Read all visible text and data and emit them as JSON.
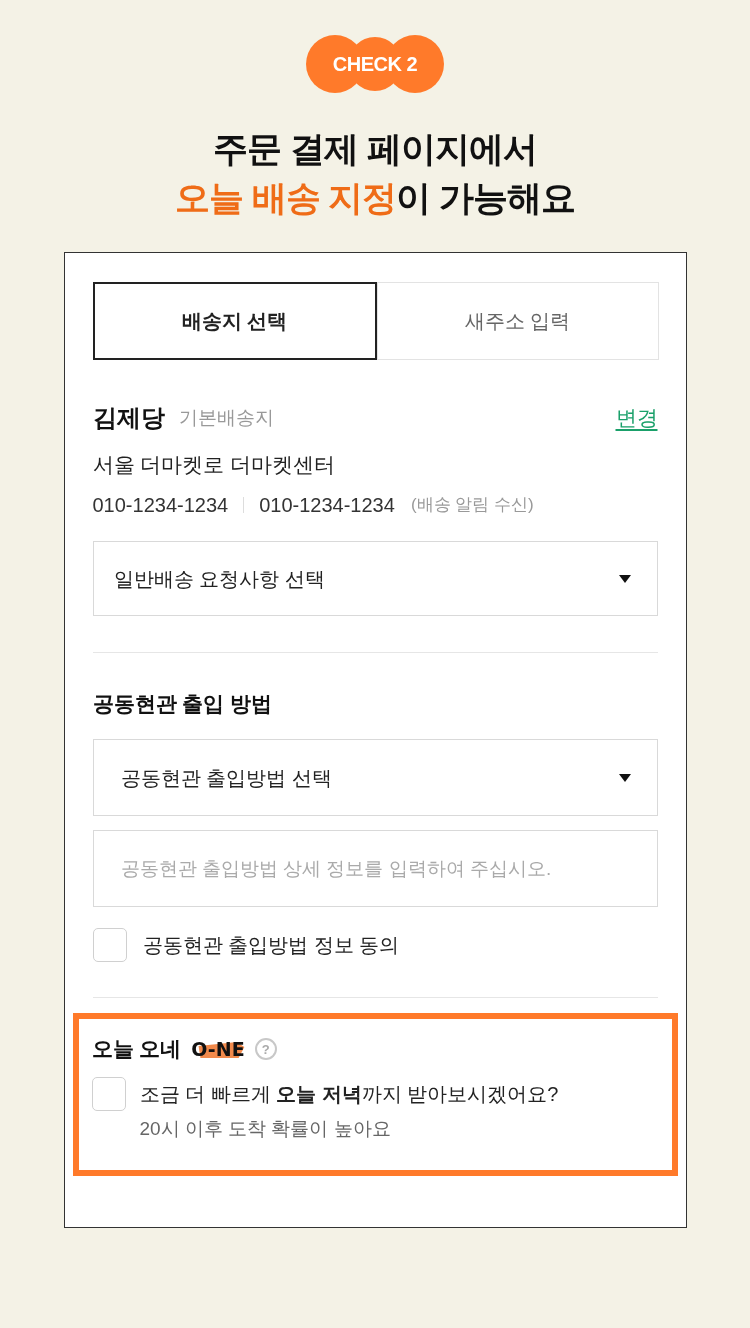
{
  "badge": {
    "label": "CHECK 2"
  },
  "headline": {
    "line_1": "주문 결제 페이지에서",
    "line_2": [
      {
        "text": "오늘 배송 지정",
        "highlight": true
      },
      {
        "text": "이 가능해요",
        "highlight": false
      }
    ]
  },
  "tabs": [
    {
      "label": "배송지 선택",
      "selected": true
    },
    {
      "label": "새주소 입력",
      "selected": false
    }
  ],
  "address": {
    "name": "김제당",
    "tag": "기본배송지",
    "change_link": "변경",
    "street": "서울 더마켓로 더마켓센터",
    "phones": [
      "010-1234-1234",
      "010-1234-1234"
    ],
    "phone_note": "(배송 알림 수신)"
  },
  "delivery_request": {
    "value": "일반배송 요청사항 선택"
  },
  "entrance": {
    "heading": "공동현관 출입 방법",
    "method_select": {
      "value": "공동현관 출입방법 선택"
    },
    "detail_field": {
      "placeholder": "공동현관 출입방법 상세 정보를 입력하여 주십시오."
    },
    "consent": {
      "label": "공동현관 출입방법 정보 동의",
      "checked": false
    }
  },
  "today_delivery": {
    "title": "오늘 오네",
    "logo": "O-NE",
    "help": "?",
    "option": {
      "label": "조금 더 빠르게 **오늘 저녁**까지 받아보시겠어요?",
      "checked": false
    },
    "note": "20시 이후 도착 확률이 높아요"
  }
}
